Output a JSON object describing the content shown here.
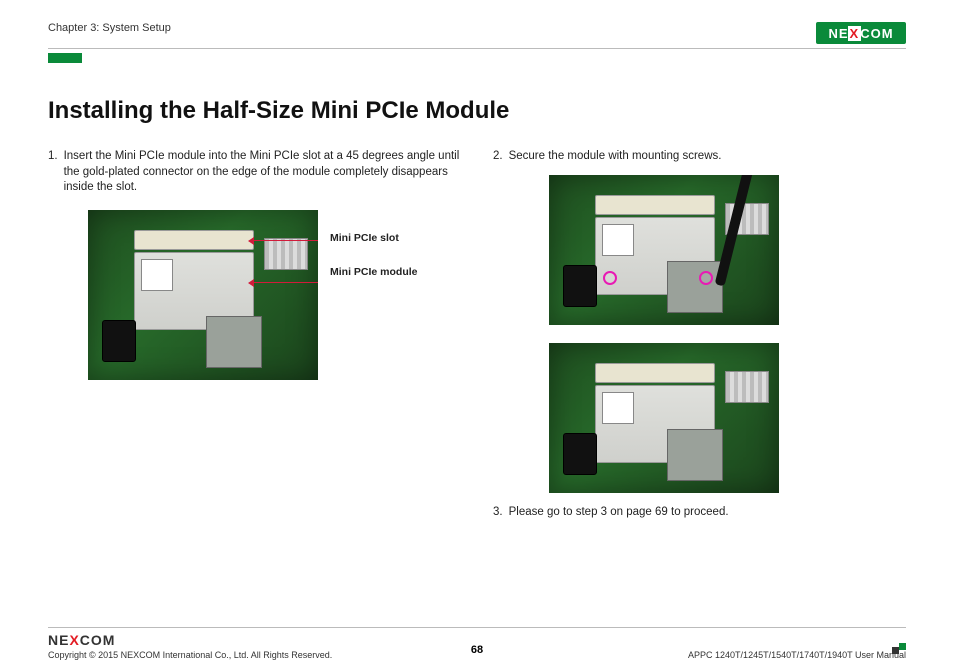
{
  "header": {
    "chapter": "Chapter 3: System Setup",
    "logo_text_left": "NE",
    "logo_text_x": "X",
    "logo_text_right": "COM"
  },
  "title": "Installing the Half-Size Mini PCIe Module",
  "left": {
    "step1_num": "1.",
    "step1_text": "Insert the Mini PCIe module into the Mini PCIe slot at a 45 degrees angle until the gold-plated connector on the edge of the module completely disappears inside the slot.",
    "callout_slot": "Mini PCIe slot",
    "callout_module": "Mini PCIe module"
  },
  "right": {
    "step2_num": "2.",
    "step2_text": "Secure the module with mounting screws.",
    "step3_num": "3.",
    "step3_text": "Please go to step 3 on page 69 to proceed."
  },
  "footer": {
    "logo_left": "NE",
    "logo_x": "X",
    "logo_right": "COM",
    "copyright": "Copyright © 2015 NEXCOM International Co., Ltd. All Rights Reserved.",
    "page_number": "68",
    "manual_ref": "APPC 1240T/1245T/1540T/1740T/1940T User Manual"
  }
}
